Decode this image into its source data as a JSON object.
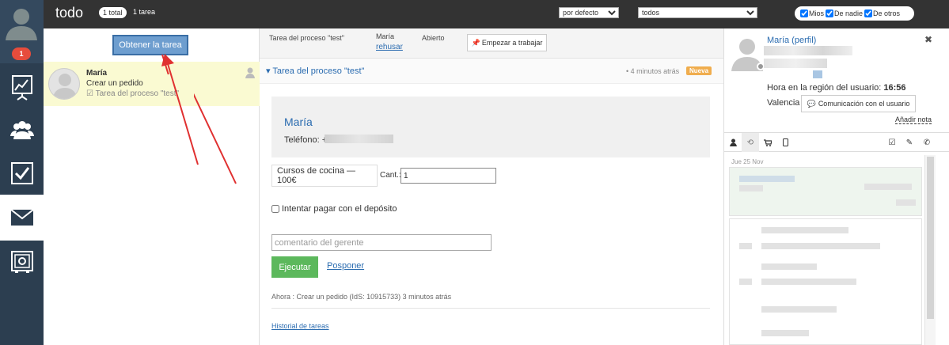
{
  "nav": {
    "badge": "1",
    "items": [
      "dashboard-icon",
      "contacts-icon",
      "tasks-icon",
      "mail-icon",
      "safe-icon"
    ]
  },
  "topbar": {
    "title": "todo",
    "total_pill": "1 total",
    "count_text": "1 tarea",
    "sort_value": "por defecto",
    "filter_value": "todos",
    "checks": [
      "Mios",
      "De nadie",
      "De otros"
    ]
  },
  "left": {
    "get_task_label": "Obtener la tarea",
    "task": {
      "name": "María",
      "action": "Crear un pedido",
      "process": "Tarea del proceso \"test\""
    }
  },
  "middle": {
    "tab_process": "Tarea del proceso \"test\"",
    "tab_user": "María",
    "tab_reject": "rehusar",
    "tab_status": "Abierto",
    "start_btn": "Empezar a trabajar",
    "task_title": "Tarea del proceso \"test\"",
    "time_ago": "• 4 minutos atrás",
    "new_badge": "Nueva",
    "contact_name": "María",
    "phone_label": "Teléfono: +",
    "product": "Cursos de cocina — 100€",
    "qty_label": "Cant.:",
    "qty_value": "1",
    "deposit_label": "Intentar pagar con el depósito",
    "comment_placeholder": "comentario del gerente",
    "exec_btn": "Ejecutar",
    "postpone": "Posponer",
    "now_text": "Ahora : Crear un pedido (IdS: 10915733) 3 minutos atrás",
    "history": "Historial de tareas"
  },
  "right": {
    "name_link": "María (perfil)",
    "close": "✖",
    "time_label": "Hora en la región del usuario: ",
    "time_value": "16:56",
    "city": "Valencia",
    "comm_btn": "Comunicación con el usuario",
    "add_note": "Añadir nota",
    "feed_date": "Jue 25 Nov"
  },
  "colors": {
    "nav_bg": "#2c3e50",
    "accent": "#2b6cb0",
    "exec": "#5cb85c",
    "new_badge": "#f0ad4e",
    "get_task": "#6e9ecf"
  }
}
